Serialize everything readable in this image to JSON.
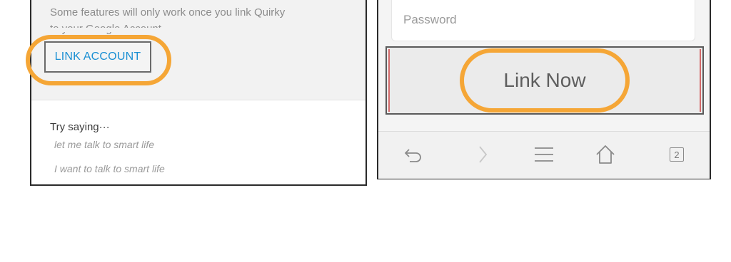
{
  "left": {
    "notice_line1": "Some features will only work once you link Quirky",
    "notice_line2": "to your Google Account.",
    "link_account_label": "LINK ACCOUNT",
    "try_title": "Try saying···",
    "try_examples": [
      "let me talk to smart life",
      "I want to talk to smart life"
    ]
  },
  "right": {
    "password_placeholder": "Password",
    "link_now_label": "Link Now",
    "nav": {
      "back_icon": "back-icon",
      "forward_icon": "forward-icon",
      "menu_icon": "menu-icon",
      "home_icon": "home-icon",
      "tab_count": "2"
    }
  },
  "colors": {
    "highlight_ring": "#f5a636",
    "link_blue": "#1a8fd3"
  }
}
